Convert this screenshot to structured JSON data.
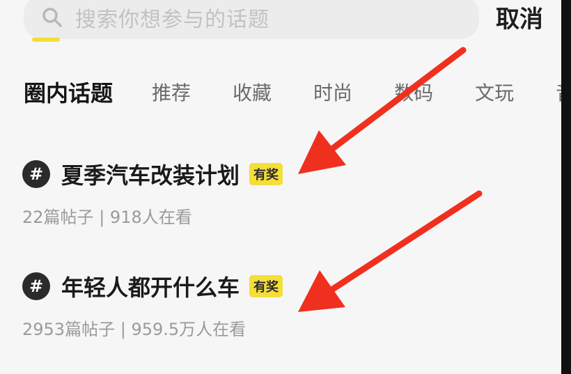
{
  "search": {
    "placeholder": "搜索你想参与的话题",
    "cancel_label": "取消"
  },
  "tabs": [
    {
      "label": "圈内话题",
      "active": true
    },
    {
      "label": "推荐",
      "active": false
    },
    {
      "label": "收藏",
      "active": false
    },
    {
      "label": "时尚",
      "active": false
    },
    {
      "label": "数码",
      "active": false
    },
    {
      "label": "文玩",
      "active": false
    },
    {
      "label": "音",
      "active": false
    }
  ],
  "topics": [
    {
      "title": "夏季汽车改装计划",
      "badge": "有奖",
      "posts": "22篇帖子",
      "separator": "|",
      "viewers": "918人在看"
    },
    {
      "title": "年轻人都开什么车",
      "badge": "有奖",
      "posts": "2953篇帖子",
      "separator": "|",
      "viewers": "959.5万人在看"
    }
  ],
  "colors": {
    "accent_yellow": "#f3de3a",
    "arrow_red": "#f0301e",
    "background": "#f6f6f6"
  },
  "icons": {
    "search": "search-icon",
    "hash": "hash-icon",
    "arrow": "arrow-annotation"
  }
}
